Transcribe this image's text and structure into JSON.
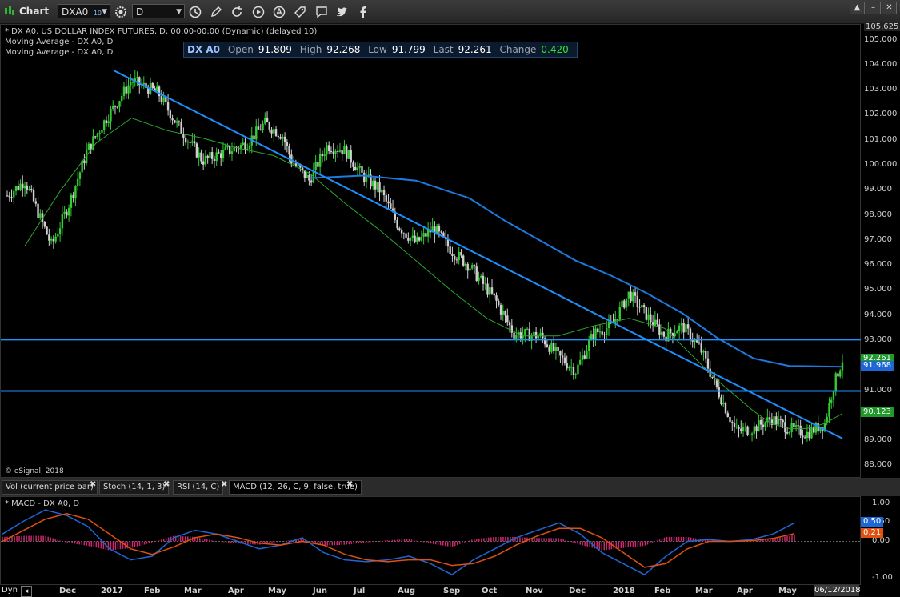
{
  "toolbar": {
    "title": "Chart",
    "symbol": "DXA0",
    "symbol_sup": "10",
    "interval": "D",
    "icons": [
      "settings-icon",
      "clock-icon",
      "pen-icon",
      "refresh-icon",
      "play-icon",
      "alert-icon",
      "tag-icon",
      "comment-icon",
      "twitter-icon",
      "facebook-icon"
    ]
  },
  "chart": {
    "header_lines": [
      "* DX A0, US DOLLAR INDEX FUTURES, D, 00:00-00:00 (Dynamic) (delayed 10)",
      "Moving Average - DX A0, D",
      "Moving Average - DX A0, D"
    ],
    "copyright": "© eSignal, 2018",
    "quote": {
      "symbol": "DX A0",
      "open_label": "Open",
      "open": "91.809",
      "high_label": "High",
      "high": "92.268",
      "low_label": "Low",
      "low": "91.799",
      "last_label": "Last",
      "last": "92.261",
      "change_label": "Change",
      "change": "0.420"
    },
    "y_top_label": "105.625",
    "y_ticks": [
      "105.000",
      "104.000",
      "103.000",
      "102.000",
      "101.000",
      "100.000",
      "99.000",
      "98.000",
      "97.000",
      "96.000",
      "95.000",
      "94.000",
      "93.000",
      "92.000",
      "91.000",
      "90.000",
      "89.000",
      "88.000"
    ],
    "price_tags": [
      {
        "value": "92.261",
        "color": "#1f9a2a"
      },
      {
        "value": "91.968",
        "color": "#1d66d6"
      },
      {
        "value": "90.123",
        "color": "#1f9a2a"
      }
    ]
  },
  "tabs": [
    {
      "label": "Vol (current price bar)"
    },
    {
      "label": "Stoch (14, 1, 3)"
    },
    {
      "label": "RSI (14, C)"
    },
    {
      "label": "MACD (12, 26, C, 9, false, true)"
    }
  ],
  "macd": {
    "title": "* MACD - DX A0, D",
    "y_ticks": [
      "1.00",
      "0.50",
      "0.00",
      "-1.00"
    ],
    "tags": [
      {
        "value": "0.50",
        "color": "#1d66d6"
      },
      {
        "value": "0.21",
        "color": "#e0500f"
      }
    ]
  },
  "time_axis": {
    "mode": "Dyn",
    "labels": [
      "Dec",
      "2017",
      "Feb",
      "Mar",
      "Apr",
      "May",
      "Jun",
      "Jul",
      "Aug",
      "Sep",
      "Oct",
      "Nov",
      "Dec",
      "2018",
      "Feb",
      "Mar",
      "Apr",
      "May"
    ],
    "end_date": "06/12/2018"
  },
  "chart_data": {
    "type": "candlestick",
    "y_range": [
      87.5,
      105.625
    ],
    "x_labels": [
      "Dec",
      "2017",
      "Feb",
      "Mar",
      "Apr",
      "May",
      "Jun",
      "Jul",
      "Aug",
      "Sep",
      "Oct",
      "Nov",
      "Dec",
      "2018",
      "Feb",
      "Mar",
      "Apr",
      "May"
    ],
    "close_path": [
      [
        0,
        98.8
      ],
      [
        2,
        99.4
      ],
      [
        5,
        96.8
      ],
      [
        7,
        98.5
      ],
      [
        9,
        100.6
      ],
      [
        11,
        101.8
      ],
      [
        14,
        103.4
      ],
      [
        17,
        102.9
      ],
      [
        19,
        101.7
      ],
      [
        22,
        100.2
      ],
      [
        25,
        100.6
      ],
      [
        27,
        100.9
      ],
      [
        29,
        101.7
      ],
      [
        31,
        101.2
      ],
      [
        32,
        100.2
      ],
      [
        34,
        99.4
      ],
      [
        36,
        100.8
      ],
      [
        38,
        100.6
      ],
      [
        40,
        99.6
      ],
      [
        42,
        99.0
      ],
      [
        44,
        97.6
      ],
      [
        46,
        96.9
      ],
      [
        48,
        97.5
      ],
      [
        50,
        96.6
      ],
      [
        52,
        96.0
      ],
      [
        55,
        94.6
      ],
      [
        57,
        93.3
      ],
      [
        60,
        93.2
      ],
      [
        62,
        92.4
      ],
      [
        64,
        91.8
      ],
      [
        66,
        93.3
      ],
      [
        68,
        93.6
      ],
      [
        70,
        94.9
      ],
      [
        72,
        94.0
      ],
      [
        74,
        93.2
      ],
      [
        76,
        93.6
      ],
      [
        78,
        92.7
      ],
      [
        80,
        91.0
      ],
      [
        82,
        89.4
      ],
      [
        84,
        89.5
      ],
      [
        86,
        89.9
      ],
      [
        88,
        89.5
      ],
      [
        90,
        89.3
      ],
      [
        92,
        89.7
      ],
      [
        93,
        91.2
      ],
      [
        94,
        92.26
      ]
    ],
    "lines": [
      {
        "name": "Moving Average",
        "color": "#2da82d",
        "points": [
          [
            2,
            96.8
          ],
          [
            6,
            99.0
          ],
          [
            10,
            100.9
          ],
          [
            14,
            101.9
          ],
          [
            18,
            101.4
          ],
          [
            22,
            101.1
          ],
          [
            26,
            100.7
          ],
          [
            30,
            100.4
          ],
          [
            34,
            99.7
          ],
          [
            38,
            98.5
          ],
          [
            42,
            97.4
          ],
          [
            46,
            96.2
          ],
          [
            50,
            95.0
          ],
          [
            54,
            93.9
          ],
          [
            58,
            93.2
          ],
          [
            62,
            93.2
          ],
          [
            66,
            93.6
          ],
          [
            70,
            93.9
          ],
          [
            74,
            93.5
          ],
          [
            76,
            92.8
          ],
          [
            80,
            91.4
          ],
          [
            84,
            90.2
          ],
          [
            86,
            89.7
          ],
          [
            88,
            89.5
          ],
          [
            90,
            89.5
          ],
          [
            92,
            89.7
          ],
          [
            94,
            90.1
          ]
        ]
      },
      {
        "name": "Moving Average",
        "color": "#1d7adf",
        "points": [
          [
            34,
            99.5
          ],
          [
            40,
            99.6
          ],
          [
            46,
            99.4
          ],
          [
            52,
            98.7
          ],
          [
            56,
            97.8
          ],
          [
            60,
            97.0
          ],
          [
            64,
            96.2
          ],
          [
            68,
            95.6
          ],
          [
            72,
            94.9
          ],
          [
            76,
            94.1
          ],
          [
            80,
            93.1
          ],
          [
            84,
            92.3
          ],
          [
            88,
            92.0
          ],
          [
            94,
            91.968
          ]
        ]
      },
      {
        "name": "Trendline",
        "color": "#1e90ff",
        "points": [
          [
            12,
            103.8
          ],
          [
            94,
            89.1
          ]
        ]
      },
      {
        "name": "Horizontal",
        "color": "#1e90ff",
        "points": [
          [
            0,
            93.05
          ],
          [
            94,
            93.05
          ]
        ]
      },
      {
        "name": "Horizontal",
        "color": "#1e90ff",
        "points": [
          [
            0,
            91.0
          ],
          [
            94,
            91.0
          ]
        ]
      }
    ],
    "macd_range": [
      -1.2,
      1.2
    ],
    "macd_line": [
      0.2,
      0.55,
      0.85,
      0.7,
      0.4,
      -0.2,
      -0.5,
      -0.4,
      0.1,
      0.3,
      0.2,
      0.0,
      -0.2,
      -0.1,
      0.1,
      -0.3,
      -0.5,
      -0.55,
      -0.5,
      -0.4,
      -0.6,
      -0.9,
      -0.5,
      -0.2,
      0.1,
      0.3,
      0.5,
      0.2,
      -0.3,
      -0.6,
      -0.9,
      -0.4,
      0.0,
      0.05,
      0.0,
      0.05,
      0.2,
      0.5
    ],
    "signal_line": [
      0.0,
      0.3,
      0.6,
      0.75,
      0.6,
      0.2,
      -0.2,
      -0.35,
      -0.15,
      0.1,
      0.2,
      0.1,
      -0.05,
      -0.1,
      0.0,
      -0.1,
      -0.35,
      -0.5,
      -0.55,
      -0.5,
      -0.5,
      -0.65,
      -0.6,
      -0.4,
      -0.1,
      0.15,
      0.35,
      0.35,
      0.1,
      -0.3,
      -0.7,
      -0.6,
      -0.2,
      0.0,
      0.0,
      0.02,
      0.08,
      0.21
    ]
  }
}
